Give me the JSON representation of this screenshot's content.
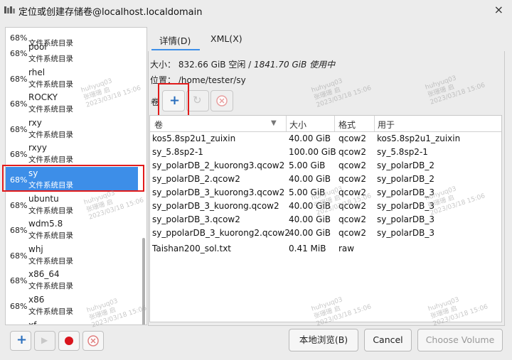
{
  "window": {
    "title": "定位或创建存储卷@localhost.localdomain",
    "close": "×"
  },
  "pools": [
    {
      "pct": "68%",
      "name": "",
      "type": "文件系统目录"
    },
    {
      "pct": "68%",
      "name": "pool",
      "type": "文件系统目录"
    },
    {
      "pct": "68%",
      "name": "rhel",
      "type": "文件系统目录"
    },
    {
      "pct": "68%",
      "name": "ROCKY",
      "type": "文件系统目录"
    },
    {
      "pct": "68%",
      "name": "rxy",
      "type": "文件系统目录"
    },
    {
      "pct": "68%",
      "name": "rxyy",
      "type": "文件系统目录"
    },
    {
      "pct": "68%",
      "name": "sy",
      "type": "文件系统目录"
    },
    {
      "pct": "68%",
      "name": "ubuntu",
      "type": "文件系统目录"
    },
    {
      "pct": "68%",
      "name": "wdm5.8",
      "type": "文件系统目录"
    },
    {
      "pct": "68%",
      "name": "whj",
      "type": "文件系统目录"
    },
    {
      "pct": "68%",
      "name": "x86_64",
      "type": "文件系统目录"
    },
    {
      "pct": "68%",
      "name": "x86",
      "type": "文件系统目录"
    },
    {
      "pct": "",
      "name": "xf",
      "type": ""
    }
  ],
  "tabs": {
    "details": "详情(D)",
    "xml": "XML(X)"
  },
  "pool_info": {
    "size_label": "大小：",
    "free": "832.66 GiB 空闲 / ",
    "used": "1841.70 GiB 使用中",
    "location_label": "位置：",
    "location": "/home/tester/sy"
  },
  "volumes_label": "卷",
  "icons": {
    "add": "+",
    "refresh": "↻",
    "delete": "×",
    "play": "▶",
    "sort": "▼"
  },
  "table": {
    "headers": [
      "卷",
      "大小",
      "格式",
      "用于"
    ],
    "rows": [
      [
        "kos5.8sp2u1_zuixin",
        "40.00 GiB",
        "qcow2",
        "kos5.8sp2u1_zuixin"
      ],
      [
        "sy_5.8sp2-1",
        "100.00 GiB",
        "qcow2",
        "sy_5.8sp2-1"
      ],
      [
        "sy_polarDB_2_kuorong3.qcow2",
        "5.00 GiB",
        "qcow2",
        "sy_polarDB_2"
      ],
      [
        "sy_polarDB_2.qcow2",
        "40.00 GiB",
        "qcow2",
        "sy_polarDB_2"
      ],
      [
        "sy_polarDB_3_kuorong3.qcow2",
        "5.00 GiB",
        "qcow2",
        "sy_polarDB_3"
      ],
      [
        "sy_polarDB_3_kuorong.qcow2",
        "40.00 GiB",
        "qcow2",
        "sy_polarDB_3"
      ],
      [
        "sy_polarDB_3.qcow2",
        "40.00 GiB",
        "qcow2",
        "sy_polarDB_3"
      ],
      [
        "sy_ppolarDB_3_kuorong2.qcow2",
        "40.00 GiB",
        "qcow2",
        "sy_polarDB_3"
      ],
      [
        "Taishan200_sol.txt",
        "0.41 MiB",
        "raw",
        ""
      ]
    ]
  },
  "buttons": {
    "browse_local": "本地浏览(B)",
    "cancel": "Cancel",
    "choose": "Choose Volume"
  },
  "watermark": {
    "line1": "huhyuq03",
    "line2": "张珊珊 启",
    "line3": "2023/03/18 15:06"
  },
  "colors": {
    "selection": "#3d8ee8",
    "add_icon": "#2a6ebd",
    "stop_red": "#d9141c",
    "highlight_box": "#e21b1b"
  }
}
